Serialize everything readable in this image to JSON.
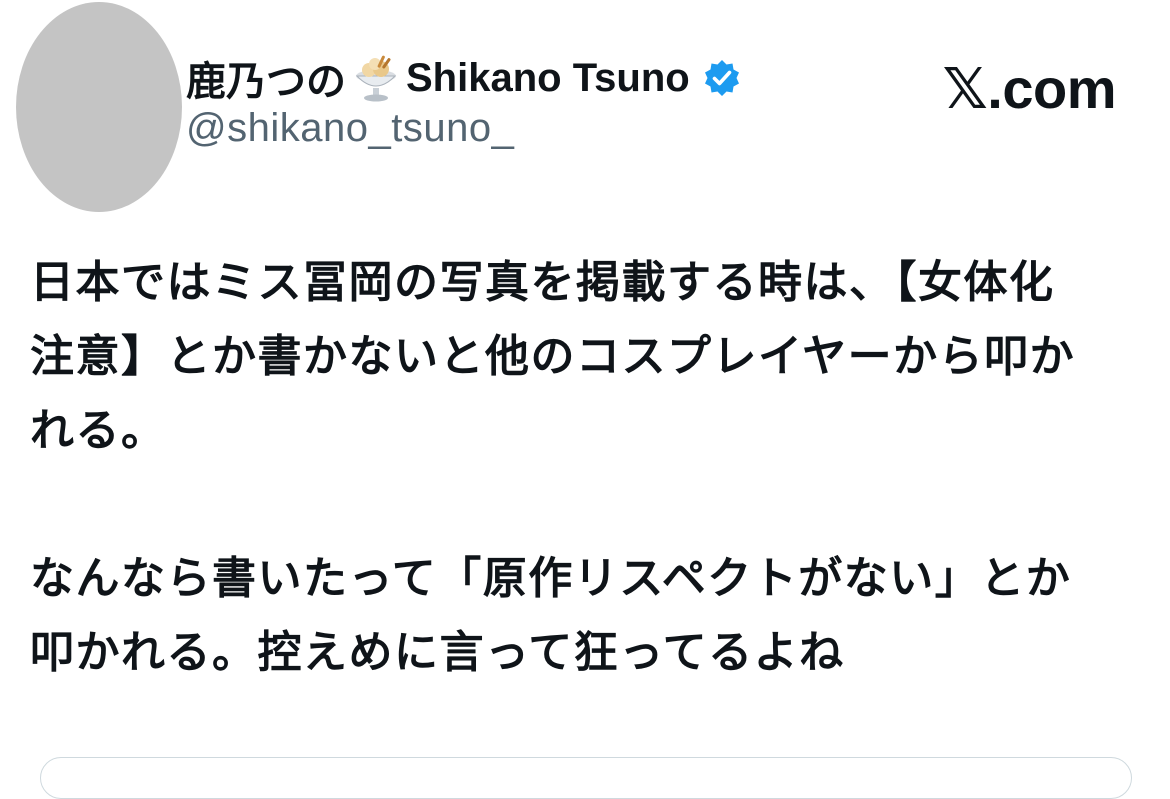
{
  "author": {
    "display_name": "鹿乃つの",
    "display_name_emoji": "ice-cream-sundae-emoji",
    "display_name_en": "Shikano Tsuno",
    "verified_icon": "verified-badge-icon",
    "handle": "@shikano_tsuno_"
  },
  "source": {
    "site": "𝕏.com"
  },
  "tweet": {
    "lines": [
      "日本ではミス冨岡の写真を掲載する時は、【女体化",
      "注意】とか書かないと他のコスプレイヤーから叩か",
      "れる。",
      "",
      "なんなら書いたって「原作リスペクトがない」とか",
      "叩かれる。控えめに言って狂ってるよね"
    ]
  },
  "colors": {
    "text": "#0f1419",
    "secondary": "#536471",
    "verified": "#1d9bf0",
    "avatar_placeholder": "#c4c4c4"
  }
}
